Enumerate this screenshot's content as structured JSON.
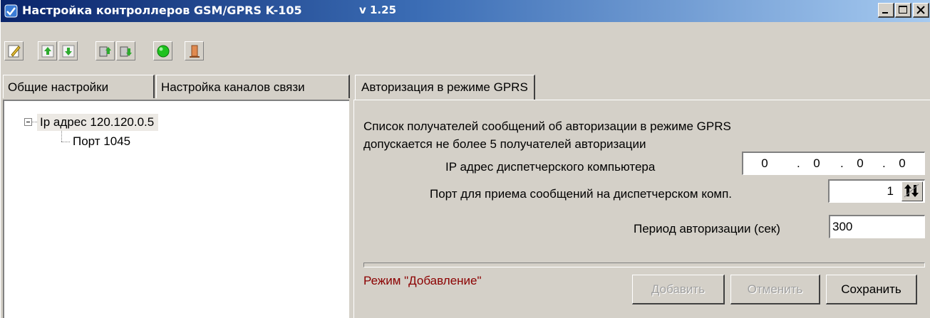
{
  "window": {
    "title": "Настройка контроллеров GSM/GPRS K-105",
    "version": "v 1.25",
    "controls": [
      "minimize",
      "maximize",
      "close"
    ]
  },
  "toolbar": {
    "buttons": [
      {
        "icon": "edit-icon"
      },
      {
        "icon": "upload-green-arrow-icon"
      },
      {
        "icon": "download-green-arrow-icon"
      },
      {
        "icon": "device-upload-icon"
      },
      {
        "icon": "device-download-icon"
      },
      {
        "icon": "green-circle-icon"
      },
      {
        "icon": "exit-door-icon"
      }
    ]
  },
  "left_tabs": [
    {
      "label": "Общие настройки"
    },
    {
      "label": "Настройка каналов связи"
    }
  ],
  "tree": {
    "root": "Ip адрес  120.120.0.5",
    "child": "Порт 1045"
  },
  "right_tab": {
    "label": "Авторизация в режиме GPRS"
  },
  "form": {
    "description_line1": "Список получателей сообщений об авторизации в режиме  GPRS",
    "description_line2": "допускается не более 5 получателей авторизации",
    "ip_label": "IP адрес диспетчерского компьютера",
    "ip_parts": [
      "0",
      "0",
      "0",
      "0"
    ],
    "port_label": "Порт для приема сообщений  на диспетчерском комп.",
    "port_value": "1",
    "period_label": "Период авторизации (сек)",
    "period_value": "300"
  },
  "status": {
    "mode_text": "Режим \"Добавление\"",
    "mode_color": "#8b0000"
  },
  "buttons": {
    "add": "Добавить",
    "cancel": "Отменить",
    "save": "Сохранить"
  }
}
